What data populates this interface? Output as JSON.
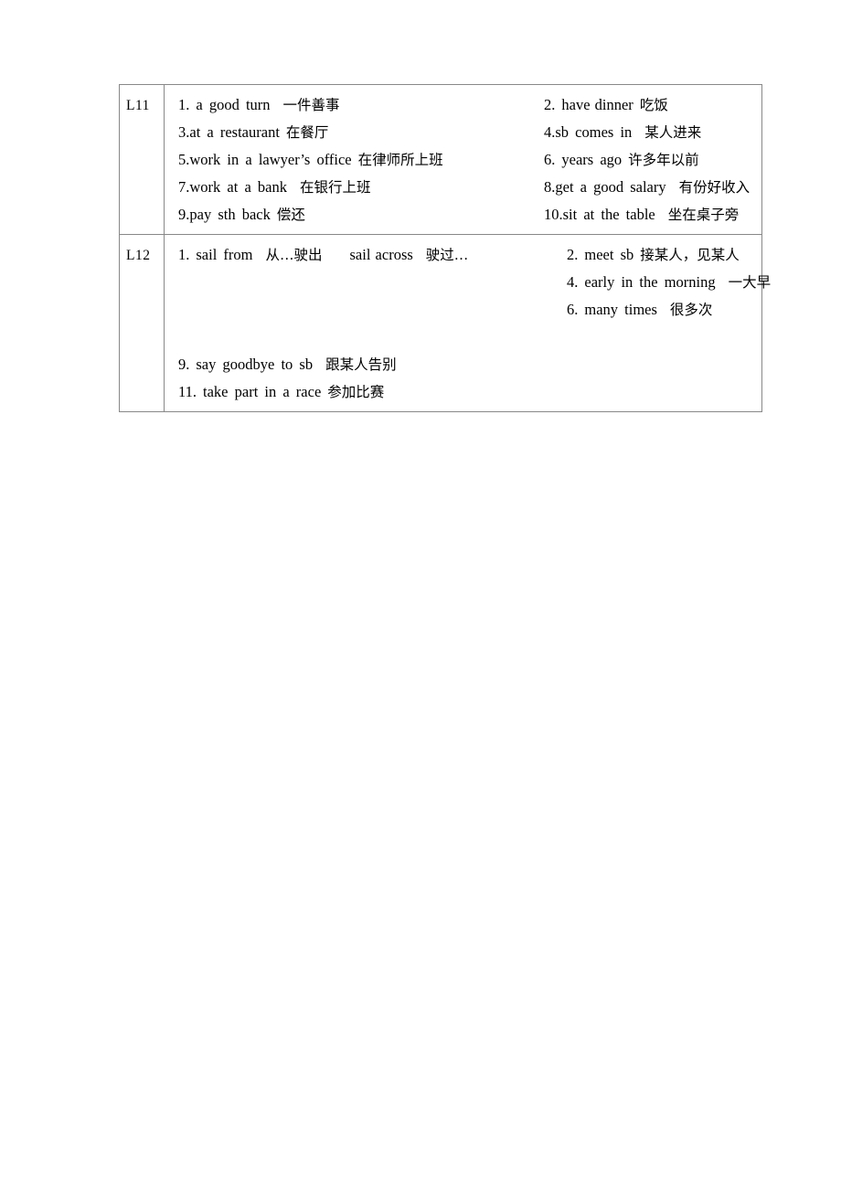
{
  "document": {
    "type": "vocabulary-table",
    "page_background": "#ffffff",
    "table_border_color": "#888888"
  },
  "table": {
    "rows": [
      {
        "label": "L11",
        "lines": [
          {
            "left": {
              "num": "1.",
              "en": "a  good  turn",
              "cn": "一件善事"
            },
            "right": {
              "num": "2.",
              "en": "have dinner",
              "cn": "吃饭"
            }
          },
          {
            "left": {
              "num": "3.",
              "en": "at  a  restaurant",
              "cn": "在餐厅"
            },
            "right": {
              "num": "4.",
              "en": "sb  comes  in",
              "cn": "某人进来"
            }
          },
          {
            "left": {
              "num": "5.",
              "en": "work  in  a  lawyer’s  office",
              "cn": "在律师所上班"
            },
            "right": {
              "num": "6.",
              "en": "years  ago",
              "cn": "许多年以前"
            }
          },
          {
            "left": {
              "num": "7.",
              "en": "work  at  a  bank",
              "cn": "在银行上班"
            },
            "right": {
              "num": "8.",
              "en": "get  a  good  salary",
              "cn": "有份好收入"
            }
          },
          {
            "left": {
              "num": "9.",
              "en": "pay  sth  back",
              "cn": "偿还"
            },
            "right": {
              "num": "10.",
              "en": "sit  at  the  table",
              "cn": "坐在桌子旁"
            }
          }
        ]
      },
      {
        "label": "L12",
        "lines": [
          {
            "left": {
              "num": "1.",
              "en": "sail  from",
              "cn": "从…驶出",
              "en2": "sail across",
              "cn2": "驶过…"
            },
            "right": {
              "num": "2.",
              "en": "meet  sb",
              "cn": "接某人，见某人"
            }
          },
          {
            "left": null,
            "right": {
              "num": "4.",
              "en": "early  in  the  morning",
              "cn": "一大早"
            }
          },
          {
            "left": null,
            "right": {
              "num": "6.",
              "en": "many  times",
              "cn": "很多次"
            }
          },
          {
            "left": null,
            "right": null
          },
          {
            "left": {
              "num": "9.",
              "en": "say  goodbye  to  sb",
              "cn": "跟某人告别"
            },
            "right": null
          },
          {
            "left": {
              "num": "11.",
              "en": "take  part  in  a  race",
              "cn": "参加比赛"
            },
            "right": null
          }
        ]
      }
    ]
  }
}
